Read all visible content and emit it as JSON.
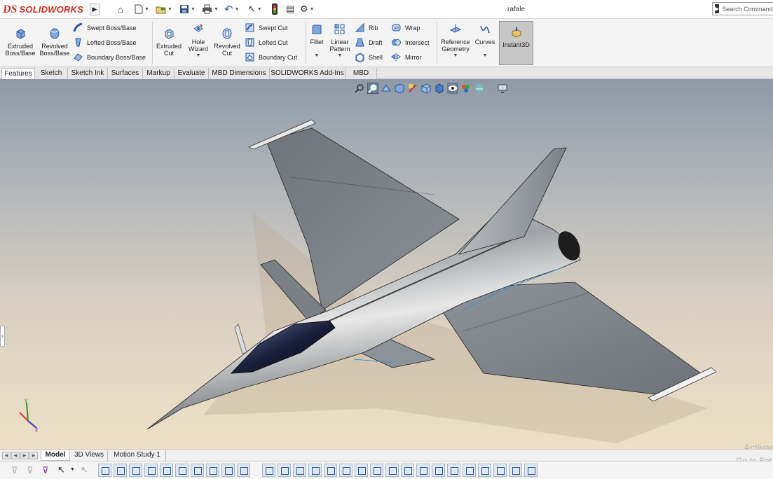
{
  "app": {
    "brand_mark": "DS",
    "brand_name": "SOLIDWORKS",
    "document_title": "rafale",
    "search_placeholder": "Search Commands"
  },
  "quick_access": [
    {
      "name": "home-icon",
      "glyph": "⌂"
    },
    {
      "name": "new-icon",
      "glyph": "🗋"
    },
    {
      "name": "open-icon",
      "glyph": "📂"
    },
    {
      "name": "save-icon",
      "glyph": "💾"
    },
    {
      "name": "print-icon",
      "glyph": "🖶"
    },
    {
      "name": "undo-icon",
      "glyph": "↶"
    },
    {
      "name": "select-icon",
      "glyph": "↖"
    },
    {
      "name": "rebuild-icon",
      "glyph": "●"
    },
    {
      "name": "file-properties-icon",
      "glyph": "▤"
    },
    {
      "name": "options-icon",
      "glyph": "⚙"
    }
  ],
  "features": {
    "extruded_boss": "Extruded Boss/Base",
    "revolved_boss": "Revolved Boss/Base",
    "swept_boss": "Swept Boss/Base",
    "lofted_boss": "Lofted Boss/Base",
    "boundary_boss": "Boundary Boss/Base",
    "extruded_cut": "Extruded Cut",
    "hole_wizard": "Hole Wizard",
    "revolved_cut": "Revolved Cut",
    "swept_cut": "Swept Cut",
    "lofted_cut": "Lofted Cut",
    "boundary_cut": "Boundary Cut",
    "fillet": "Fillet",
    "linear_pattern": "Linear Pattern",
    "rib": "Rib",
    "draft": "Draft",
    "shell": "Shell",
    "wrap": "Wrap",
    "intersect": "Intersect",
    "mirror": "Mirror",
    "reference_geometry": "Reference Geometry",
    "curves": "Curves",
    "instant3d": "Instant3D"
  },
  "tabs": [
    "Features",
    "Sketch",
    "Sketch Ink",
    "Surfaces",
    "Markup",
    "Evaluate",
    "MBD Dimensions",
    "SOLIDWORKS Add-Ins",
    "MBD"
  ],
  "active_tab": "Features",
  "bottom_tabs": [
    "Model",
    "3D Views",
    "Motion Study 1"
  ],
  "active_bottom_tab": "Model",
  "watermark": {
    "line1": "Activat",
    "line2": "Go to Set"
  },
  "colors": {
    "brand": "#d52b1e",
    "icon_blue": "#2b5aa5",
    "viewport_top": "#8f9aa6",
    "viewport_bottom": "#eee0c6"
  }
}
